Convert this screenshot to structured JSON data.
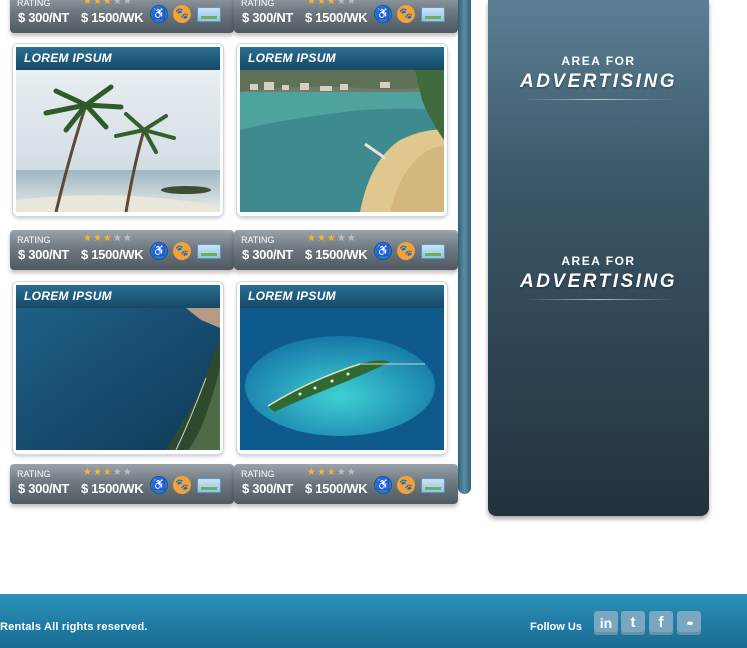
{
  "listings": [
    {
      "title": "LOREM IPSUM",
      "rating_label": "RATING",
      "night_price": "$ 300/NT",
      "week_price": "$ 1500/WK",
      "stars": 3,
      "image": "tropical-palm-beach-photo"
    },
    {
      "title": "LOREM IPSUM",
      "rating_label": "RATING",
      "night_price": "$ 300/NT",
      "week_price": "$ 1500/WK",
      "stars": 3,
      "image": "city-bay-beach-photo"
    },
    {
      "title": "LOREM IPSUM",
      "rating_label": "RATING",
      "night_price": "$ 300/NT",
      "week_price": "$ 1500/WK",
      "stars": 3,
      "image": "deep-blue-sea-coast-photo"
    },
    {
      "title": "LOREM IPSUM",
      "rating_label": "RATING",
      "night_price": "$ 300/NT",
      "week_price": "$ 1500/WK",
      "stars": 3,
      "image": "island-lagoon-aerial-photo"
    }
  ],
  "top_strips": [
    {
      "rating_label": "RATING",
      "night_price": "$ 300/NT",
      "week_price": "$ 1500/WK",
      "stars": 3
    },
    {
      "rating_label": "RATING",
      "night_price": "$ 300/NT",
      "week_price": "$ 1500/WK",
      "stars": 3
    }
  ],
  "strip_icons": [
    "wheelchair-icon",
    "paw-icon",
    "credit-card-icon"
  ],
  "ads": [
    {
      "small": "AREA FOR",
      "big": "ADVERTISING"
    },
    {
      "small": "AREA FOR",
      "big": "ADVERTISING"
    }
  ],
  "footer": {
    "copyright": "Rentals  All rights reserved.",
    "follow_label": "Follow Us",
    "social": [
      {
        "icon": "linkedin-icon",
        "glyph": "in"
      },
      {
        "icon": "twitter-icon",
        "glyph": "t"
      },
      {
        "icon": "facebook-icon",
        "glyph": "f"
      },
      {
        "icon": "flickr-icon",
        "glyph": "••"
      }
    ]
  },
  "colors": {
    "card_header": "#1d5675",
    "strip": "#6f7980",
    "ad_panel_top": "#5b7f93",
    "ad_panel_bottom": "#22323d",
    "footer": "#1f7aa3",
    "star": "#f5b32e"
  }
}
